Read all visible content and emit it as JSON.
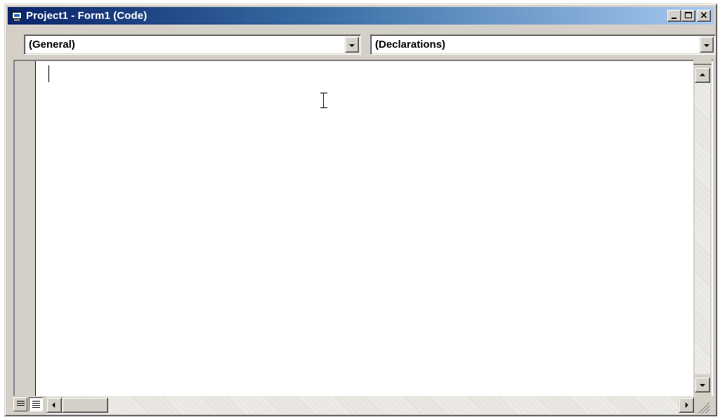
{
  "window": {
    "title": "Project1 - Form1 (Code)",
    "icons": {
      "app": "vb-form-icon",
      "minimize": "minimize-icon",
      "maximize": "maximize-icon",
      "close": "close-icon"
    }
  },
  "object_combo": {
    "selected": "(General)"
  },
  "procedure_combo": {
    "selected": "(Declarations)"
  },
  "code_editor": {
    "content": ""
  },
  "colors": {
    "title_gradient_start": "#0a246a",
    "title_gradient_end": "#a6caf0",
    "face": "#d4d0c8",
    "editor_bg": "#ffffff"
  }
}
